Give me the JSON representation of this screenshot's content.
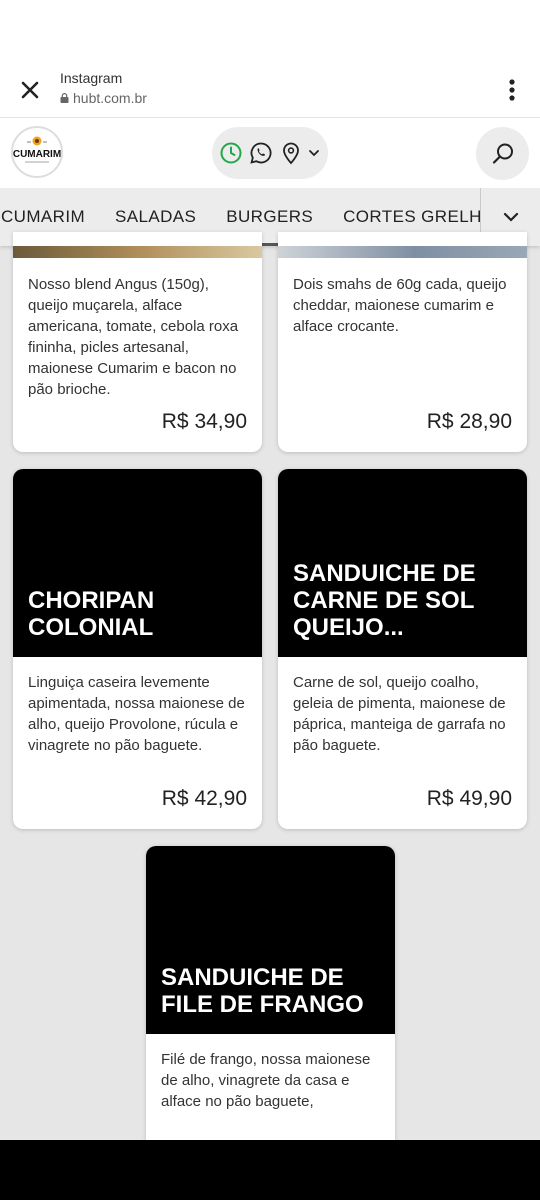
{
  "browser": {
    "title": "Instagram",
    "url": "hubt.com.br"
  },
  "colors": {
    "accent_green": "#22a84a",
    "card_image_bg": "#000000"
  },
  "header": {
    "logo_text": "CUMARIM",
    "icons": [
      "clock-icon",
      "whatsapp-icon",
      "location-pin-icon",
      "chevron-down-icon",
      "search-icon"
    ]
  },
  "categories": {
    "items": [
      "CUMARIM",
      "SALADAS",
      "BURGERS",
      "CORTES GRELHADOS"
    ],
    "active": "BURGERS"
  },
  "products": {
    "p1": {
      "description": "Nosso blend Angus (150g), queijo muçarela, alface americana, tomate, cebola roxa fininha, picles artesanal, maionese Cumarim e bacon no pão brioche.",
      "price": "R$ 34,90"
    },
    "p2": {
      "description": "Dois smahs de 60g cada, queijo cheddar, maionese cumarim e alface crocante.",
      "price": "R$ 28,90"
    },
    "p3": {
      "name": "CHORIPAN COLONIAL",
      "description": "Linguiça caseira levemente apimentada, nossa maionese de alho, queijo Provolone, rúcula e vinagrete no pão baguete.",
      "price": "R$ 42,90"
    },
    "p4": {
      "name": "SANDUICHE DE CARNE DE SOL QUEIJO...",
      "description": "Carne de sol, queijo coalho, geleia de pimenta, maionese de páprica, manteiga de garrafa no pão baguete.",
      "price": "R$ 49,90"
    },
    "p5": {
      "name": "SANDUICHE DE FILE DE FRANGO",
      "description": "Filé de frango, nossa maionese de alho, vinagrete da casa e alface no pão baguete,"
    }
  }
}
